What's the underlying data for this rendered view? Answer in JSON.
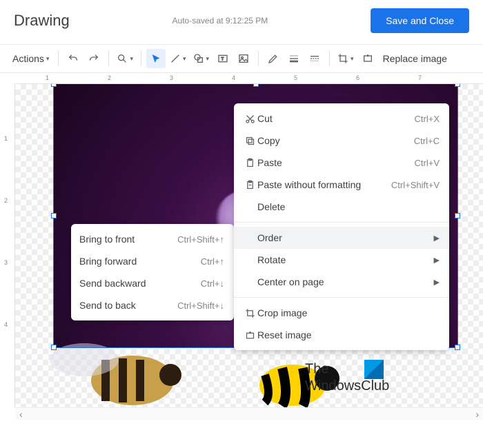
{
  "header": {
    "title": "Drawing",
    "autosave": "Auto-saved at 9:12:25 PM",
    "save_button": "Save and Close"
  },
  "toolbar": {
    "actions": "Actions",
    "replace_image": "Replace image"
  },
  "ruler_h": [
    "1",
    "2",
    "3",
    "4",
    "5",
    "6",
    "7"
  ],
  "ruler_v": [
    "1",
    "2",
    "3",
    "4"
  ],
  "watermark": {
    "line1": "The",
    "line2": "WindowsClub"
  },
  "context_menu": {
    "cut": {
      "label": "Cut",
      "shortcut": "Ctrl+X"
    },
    "copy": {
      "label": "Copy",
      "shortcut": "Ctrl+C"
    },
    "paste": {
      "label": "Paste",
      "shortcut": "Ctrl+V"
    },
    "paste_plain": {
      "label": "Paste without formatting",
      "shortcut": "Ctrl+Shift+V"
    },
    "delete": {
      "label": "Delete"
    },
    "order": {
      "label": "Order"
    },
    "rotate": {
      "label": "Rotate"
    },
    "center": {
      "label": "Center on page"
    },
    "crop": {
      "label": "Crop image"
    },
    "reset": {
      "label": "Reset image"
    }
  },
  "order_submenu": {
    "bring_front": {
      "label": "Bring to front",
      "shortcut": "Ctrl+Shift+↑"
    },
    "bring_forward": {
      "label": "Bring forward",
      "shortcut": "Ctrl+↑"
    },
    "send_backward": {
      "label": "Send backward",
      "shortcut": "Ctrl+↓"
    },
    "send_back": {
      "label": "Send to back",
      "shortcut": "Ctrl+Shift+↓"
    }
  }
}
